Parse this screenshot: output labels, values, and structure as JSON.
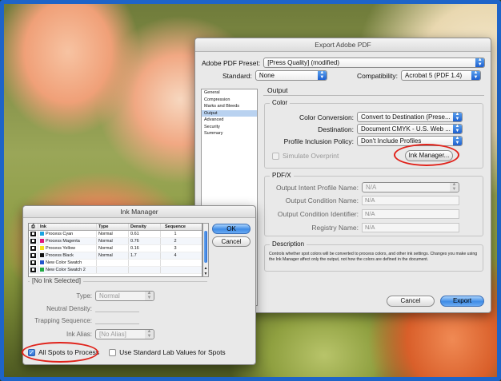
{
  "export": {
    "title": "Export Adobe PDF",
    "preset_label": "Adobe PDF Preset:",
    "preset_value": "[Press Quality] (modified)",
    "standard_label": "Standard:",
    "standard_value": "None",
    "compat_label": "Compatibility:",
    "compat_value": "Acrobat 5 (PDF 1.4)",
    "sidebar": [
      "General",
      "Compression",
      "Marks and Bleeds",
      "Output",
      "Advanced",
      "Security",
      "Summary"
    ],
    "sidebar_selected": "Output",
    "panel_title": "Output",
    "color_group": "Color",
    "color_conversion_label": "Color Conversion:",
    "color_conversion_value": "Convert to Destination (Prese...",
    "destination_label": "Destination:",
    "destination_value": "Document CMYK - U.S. Web ...",
    "profile_label": "Profile Inclusion Policy:",
    "profile_value": "Don't Include Profiles",
    "simulate_label": "Simulate Overprint",
    "ink_manager_label": "Ink Manager...",
    "pdfx_group": "PDF/X",
    "intent_label": "Output Intent Profile Name:",
    "intent_value": "N/A",
    "condition_label": "Output Condition Name:",
    "condition_value": "N/A",
    "identifier_label": "Output Condition Identifier:",
    "identifier_value": "N/A",
    "registry_label": "Registry Name:",
    "registry_value": "N/A",
    "description_group": "Description",
    "description_text": "Controls whether spot colors will be converted to process colors, and other ink settings. Changes you make using the Ink Manager affect only the output, not how the colors are defined in the document.",
    "cancel_label": "Cancel",
    "export_label": "Export"
  },
  "ink": {
    "title": "Ink Manager",
    "columns": [
      "Ink",
      "Type",
      "Density",
      "Sequence"
    ],
    "rows": [
      {
        "name": "Process Cyan",
        "color": "#19a3e0",
        "type": "Normal",
        "density": "0.61",
        "sequence": "1"
      },
      {
        "name": "Process Magenta",
        "color": "#e0187a",
        "type": "Normal",
        "density": "0.76",
        "sequence": "2"
      },
      {
        "name": "Process Yellow",
        "color": "#f4e21c",
        "type": "Normal",
        "density": "0.16",
        "sequence": "3"
      },
      {
        "name": "Process Black",
        "color": "#111111",
        "type": "Normal",
        "density": "1.7",
        "sequence": "4"
      },
      {
        "name": "New Color Swatch",
        "color": "#2255cc",
        "type": "",
        "density": "",
        "sequence": ""
      },
      {
        "name": "New Color Swatch 2",
        "color": "#22aa44",
        "type": "",
        "density": "",
        "sequence": ""
      }
    ],
    "ok_label": "OK",
    "cancel_label": "Cancel",
    "no_ink_label": "[No Ink Selected]",
    "type_label": "Type:",
    "type_value": "Normal",
    "neutral_label": "Neutral Density:",
    "trapping_label": "Trapping Sequence:",
    "alias_label": "Ink Alias:",
    "alias_value": "[No Alias]",
    "all_spots_label": "All Spots to Process",
    "lab_label": "Use Standard Lab Values for Spots"
  },
  "accent_color": "#1e64c8",
  "highlight_color": "#e0221a"
}
